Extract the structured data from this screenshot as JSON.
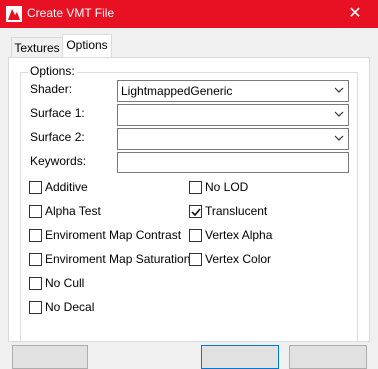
{
  "window": {
    "title": "Create VMT File",
    "close_icon": "close-icon"
  },
  "tabs": [
    {
      "label": "Textures",
      "active": false
    },
    {
      "label": "Options",
      "active": true
    }
  ],
  "options_group": {
    "title": "Options:"
  },
  "fields": {
    "shader": {
      "label": "Shader:",
      "value": "LightmappedGeneric"
    },
    "surface1": {
      "label": "Surface 1:",
      "value": ""
    },
    "surface2": {
      "label": "Surface 2:",
      "value": ""
    },
    "keywords": {
      "label": "Keywords:",
      "value": ""
    }
  },
  "checkboxes_left": [
    {
      "label": "Additive",
      "checked": false
    },
    {
      "label": "Alpha Test",
      "checked": false
    },
    {
      "label": "Enviroment Map Contrast",
      "checked": false
    },
    {
      "label": "Enviroment Map Saturation",
      "checked": false
    },
    {
      "label": "No Cull",
      "checked": false
    },
    {
      "label": "No Decal",
      "checked": false
    }
  ],
  "checkboxes_right": [
    {
      "label": "No LOD",
      "checked": false
    },
    {
      "label": "Translucent",
      "checked": true
    },
    {
      "label": "Vertex Alpha",
      "checked": false
    },
    {
      "label": "Vertex Color",
      "checked": false
    }
  ],
  "colors": {
    "titlebar": "#e81123",
    "accent": "#0078d7"
  }
}
